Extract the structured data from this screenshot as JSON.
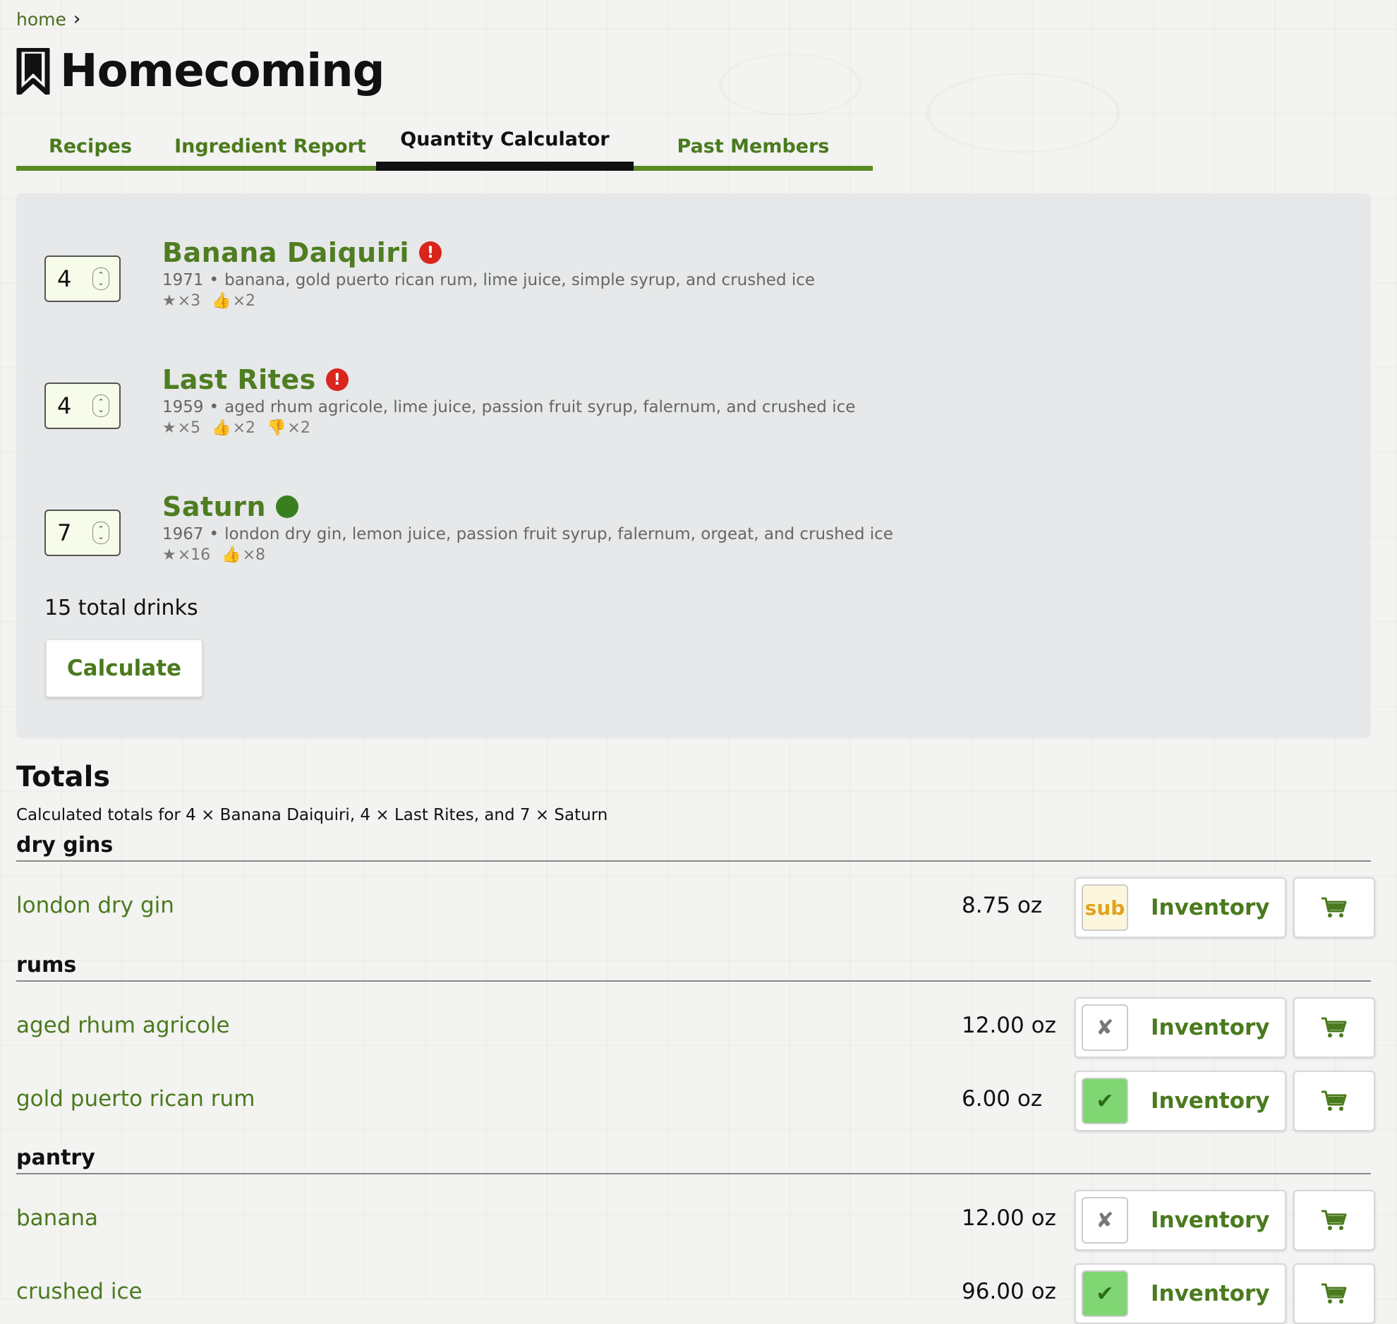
{
  "breadcrumb": {
    "home": "home"
  },
  "page": {
    "title": "Homecoming"
  },
  "tabs": [
    "Recipes",
    "Ingredient Report",
    "Quantity Calculator",
    "Past Members"
  ],
  "active_tab": "Quantity Calculator",
  "recipes": [
    {
      "quantity": "4",
      "name": "Banana Daiquiri",
      "badge": "alert",
      "badge_text": "!",
      "year": "1971",
      "ingredients": "banana, gold puerto rican rum, lime juice, simple syrup, and crushed ice",
      "stats": {
        "stars": "×3",
        "thumbs_up": "×2"
      }
    },
    {
      "quantity": "4",
      "name": "Last Rites",
      "badge": "alert",
      "badge_text": "!",
      "year": "1959",
      "ingredients": "aged rhum agricole, lime juice, passion fruit syrup, falernum, and crushed ice",
      "stats": {
        "stars": "×5",
        "thumbs_up": "×2",
        "thumbs_down": "×2"
      }
    },
    {
      "quantity": "7",
      "name": "Saturn",
      "badge": "ok",
      "year": "1967",
      "ingredients": "london dry gin, lemon juice, passion fruit syrup, falernum, orgeat, and crushed ice",
      "stats": {
        "stars": "×16",
        "thumbs_up": "×8"
      }
    }
  ],
  "calculator": {
    "total_drinks": "15 total drinks",
    "calculate_label": "Calculate"
  },
  "totals": {
    "heading": "Totals",
    "subtitle": "Calculated totals for 4 × Banana Daiquiri, 4 × Last Rites, and 7 × Saturn",
    "categories": [
      {
        "name": "dry gins",
        "items": [
          {
            "name": "london dry gin",
            "amount": "8.75 oz",
            "status": "sub",
            "status_text": "sub",
            "inventory_label": "Inventory"
          }
        ]
      },
      {
        "name": "rums",
        "items": [
          {
            "name": "aged rhum agricole",
            "amount": "12.00 oz",
            "status": "none",
            "status_text": "✘",
            "inventory_label": "Inventory"
          },
          {
            "name": "gold puerto rican rum",
            "amount": "6.00 oz",
            "status": "ok",
            "status_text": "✔",
            "inventory_label": "Inventory"
          }
        ]
      },
      {
        "name": "pantry",
        "items": [
          {
            "name": "banana",
            "amount": "12.00 oz",
            "status": "none",
            "status_text": "✘",
            "inventory_label": "Inventory"
          },
          {
            "name": "crushed ice",
            "amount": "96.00 oz",
            "status": "ok",
            "status_text": "✔",
            "inventory_label": "Inventory"
          }
        ]
      }
    ]
  },
  "icons": {
    "bookmark": "bookmark-icon",
    "chevron": "chevron-right-icon",
    "stepper": "stepper-icon",
    "star": "star-icon",
    "thumbs_up": "thumbs-up-icon",
    "thumbs_down": "thumbs-down-icon",
    "cart": "cart-icon"
  },
  "colors": {
    "accent_green": "#4a7a1e",
    "alert_red": "#d9261c",
    "ok_green": "#3a7f1f",
    "sub_yellow": "#e0a31e",
    "panel_bg": "#e6e8e9"
  }
}
